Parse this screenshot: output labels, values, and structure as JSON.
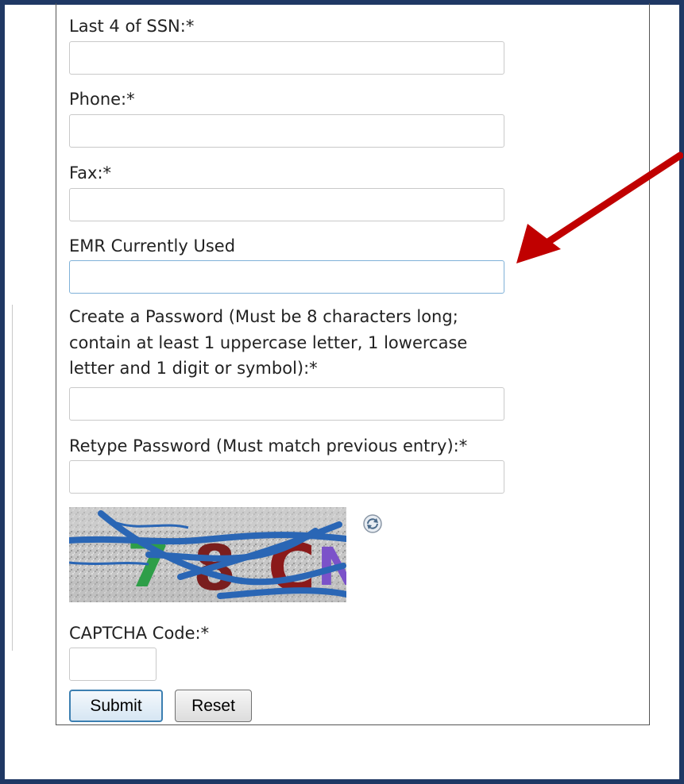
{
  "form": {
    "ssn_label": "Last 4 of SSN:*",
    "ssn_value": "",
    "phone_label": "Phone:*",
    "phone_value": "",
    "fax_label": "Fax:*",
    "fax_value": "",
    "emr_label": "EMR Currently Used",
    "emr_value": "",
    "password_label_lines": [
      "Create a Password (Must be 8 characters long;",
      "contain at least 1 uppercase letter, 1 lowercase",
      "letter and 1 digit or symbol):*"
    ],
    "password_value": "",
    "retype_label": "Retype Password (Must match previous entry):*",
    "retype_value": "",
    "captcha_text": "78CN",
    "captcha_label": "CAPTCHA Code:*",
    "captcha_value": "",
    "submit_label": "Submit",
    "reset_label": "Reset"
  },
  "colors": {
    "frame": "#1f3864",
    "arrow": "#c00000",
    "highlight_border": "#7fb1d8"
  },
  "icons": {
    "refresh": "refresh-icon",
    "annotation": "arrow-icon"
  }
}
